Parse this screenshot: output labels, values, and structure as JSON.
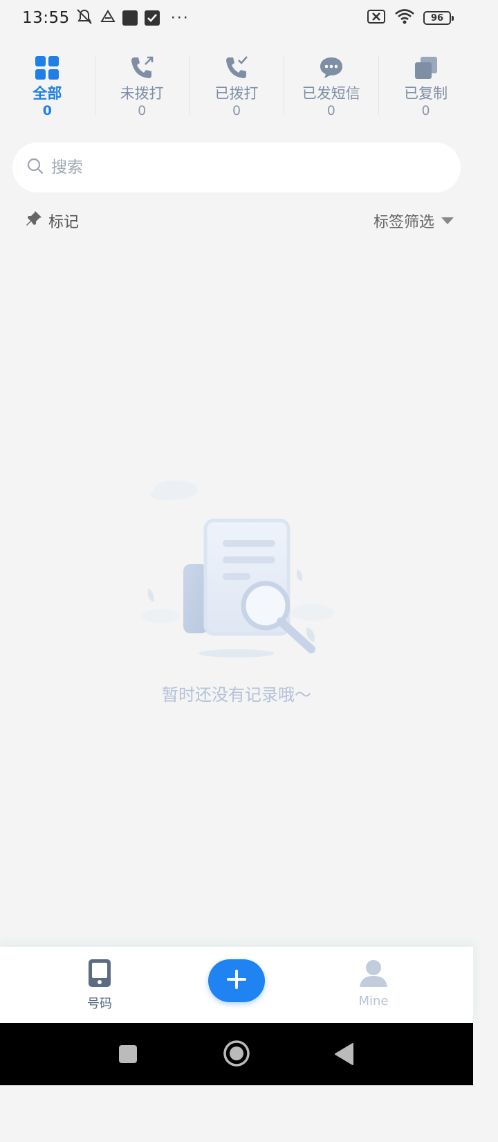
{
  "status_bar": {
    "time": "13:55",
    "dots": "···",
    "battery": "96",
    "icons": [
      "mute-icon",
      "drive-icon",
      "square-icon",
      "check-app-icon",
      "sim-off-icon",
      "wifi-icon",
      "battery-icon"
    ]
  },
  "tabs": [
    {
      "label": "全部",
      "count": "0",
      "icon": "grid-icon",
      "active": true
    },
    {
      "label": "未拨打",
      "count": "0",
      "icon": "phone-outgoing-icon",
      "active": false
    },
    {
      "label": "已拨打",
      "count": "0",
      "icon": "phone-check-icon",
      "active": false
    },
    {
      "label": "已发短信",
      "count": "0",
      "icon": "message-icon",
      "active": false
    },
    {
      "label": "已复制",
      "count": "0",
      "icon": "copy-icon",
      "active": false
    }
  ],
  "search": {
    "placeholder": "搜索",
    "value": ""
  },
  "filter": {
    "mark_label": "标记",
    "tag_filter_label": "标签筛选"
  },
  "empty_state": {
    "message": "暂时还没有记录哦～"
  },
  "bottom_nav": {
    "numbers_label": "号码",
    "mine_label": "Mine",
    "add_icon": "plus-icon"
  },
  "colors": {
    "accent": "#1f7ee8",
    "inactive": "#7e8ea4",
    "background": "#f4f4f4",
    "fab": "#1f84f2"
  }
}
